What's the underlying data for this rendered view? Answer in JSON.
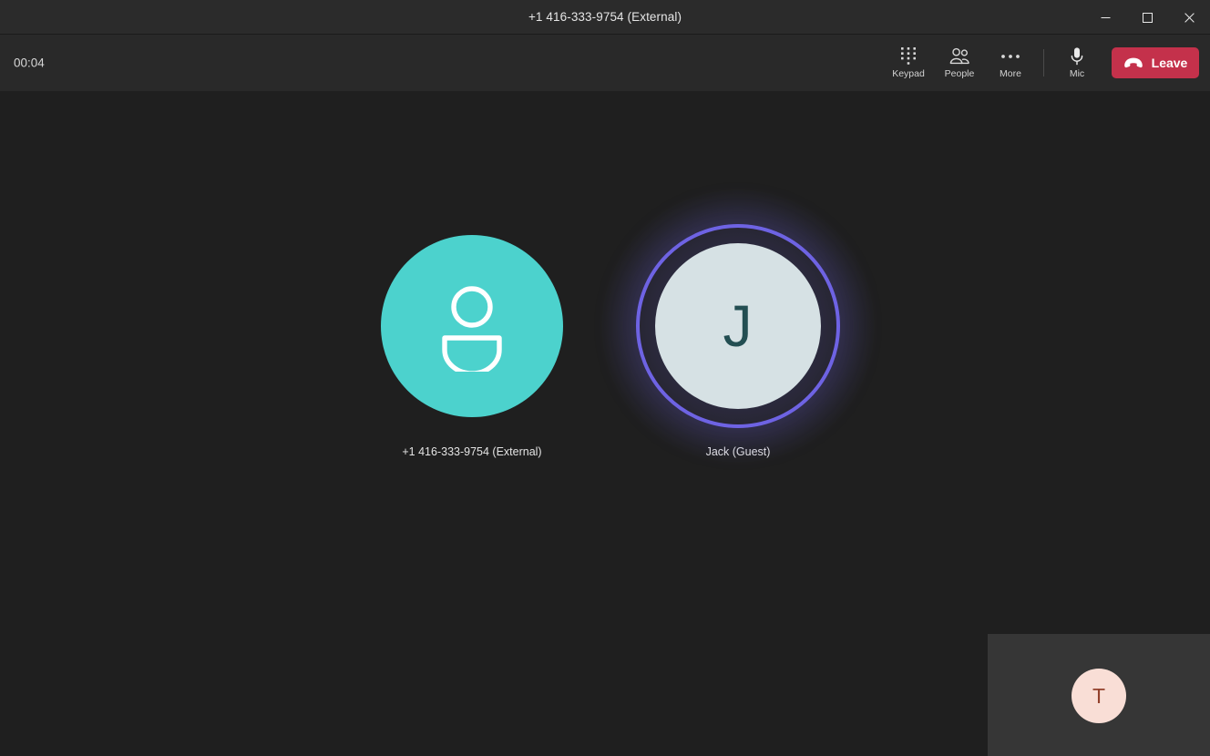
{
  "window": {
    "title": "+1 416-333-9754 (External)",
    "controls": [
      {
        "name": "minimize",
        "glyph": "minimize-icon"
      },
      {
        "name": "maximize",
        "glyph": "maximize-icon"
      },
      {
        "name": "close",
        "glyph": "close-icon"
      }
    ]
  },
  "call": {
    "duration": "00:04"
  },
  "toolbar": {
    "items": [
      {
        "label": "Keypad",
        "icon": "keypad-icon"
      },
      {
        "label": "People",
        "icon": "people-icon"
      },
      {
        "label": "More",
        "icon": "more-icon"
      },
      {
        "label": "Mic",
        "icon": "microphone-icon"
      }
    ],
    "leave": {
      "label": "Leave",
      "icon": "hangup-icon",
      "color": "#c4314b"
    }
  },
  "participants": [
    {
      "name": "+1 416-333-9754 (External)",
      "avatar_type": "person-glyph",
      "avatar_color": "#4cd2cd",
      "speaking": false
    },
    {
      "name": "Jack (Guest)",
      "avatar_type": "initials",
      "initials": "J",
      "avatar_color": "#d6e1e4",
      "initials_color": "#234e52",
      "speaking": true,
      "speaking_ring_color": "#6e63e3"
    }
  ],
  "self_view": {
    "initials": "T",
    "avatar_color": "#f9ded6",
    "initials_color": "#93412c",
    "tile_color": "#363636"
  }
}
